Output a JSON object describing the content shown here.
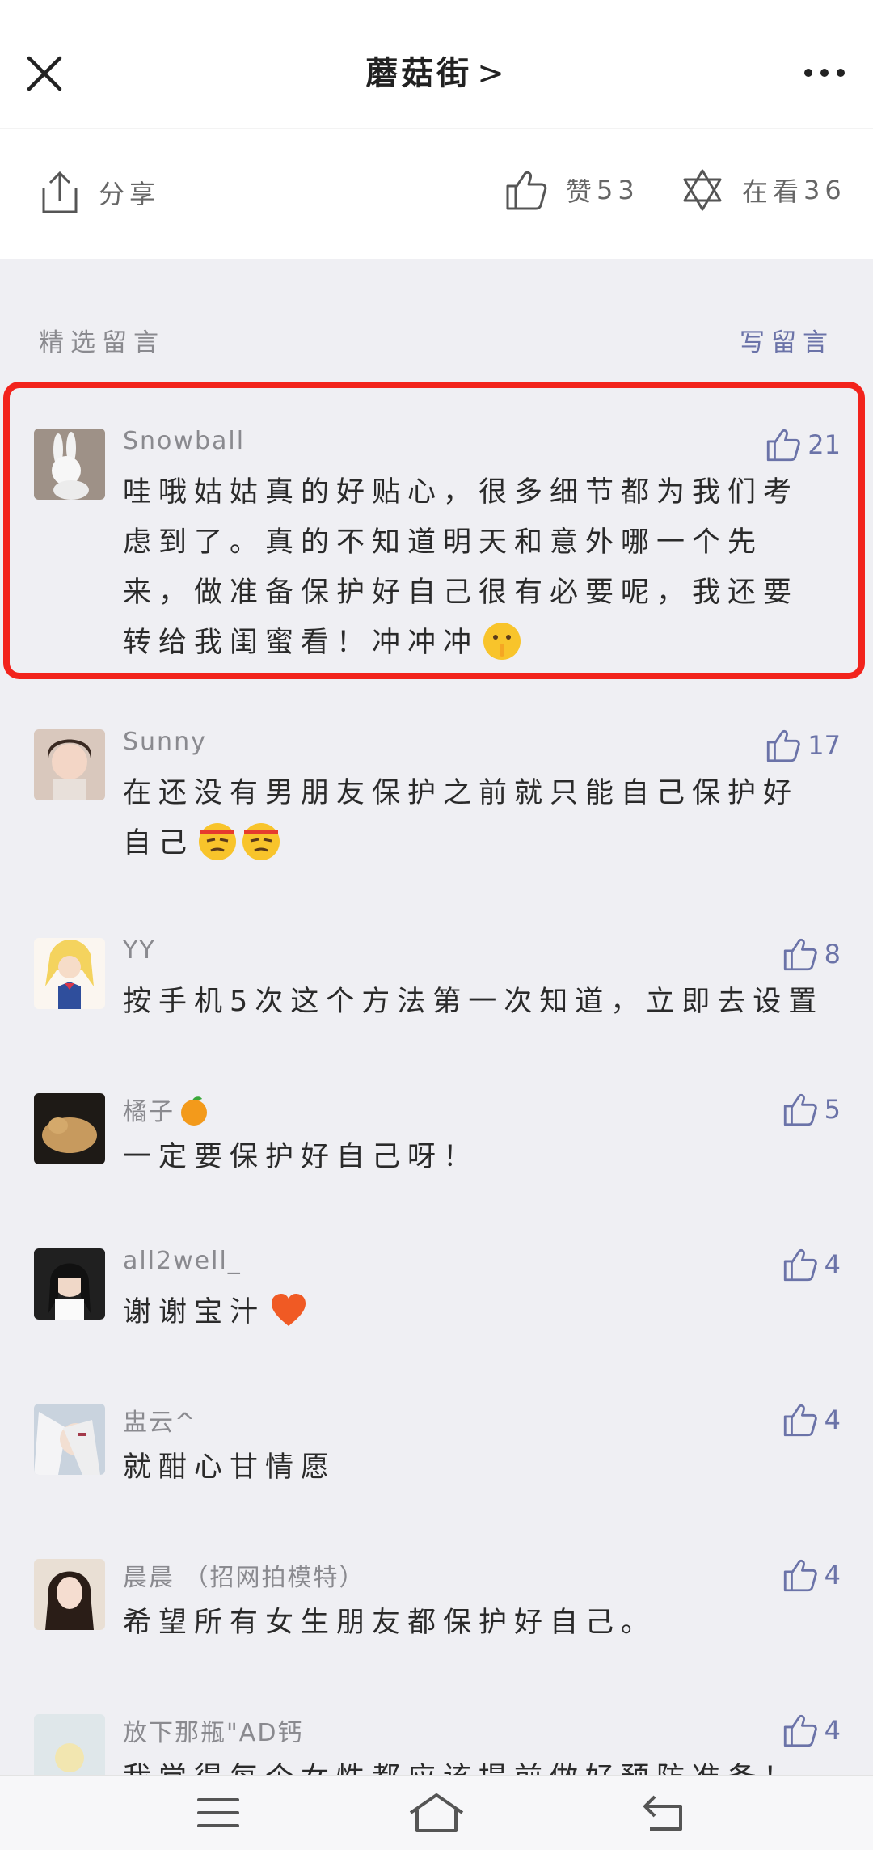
{
  "header": {
    "title": "蘑菇街",
    "title_chevron": ">"
  },
  "actions": {
    "share_label": "分享",
    "like_label": "赞",
    "like_count": "53",
    "wow_label": "在看",
    "wow_count": "36"
  },
  "section": {
    "title": "精选留言",
    "write_label": "写留言"
  },
  "comments": [
    {
      "name": "Snowball",
      "text": "哇哦姑姑真的好贴心，很多细节都为我们考虑到了。真的不知道明天和意外哪一个先来，做准备保护好自己很有必要呢，我还要转给我闺蜜看！冲冲冲",
      "likes": "21"
    },
    {
      "name": "Sunny",
      "text": "在还没有男朋友保护之前就只能自己保护好自己",
      "likes": "17"
    },
    {
      "name": "YY",
      "text": "按手机5次这个方法第一次知道，立即去设置",
      "likes": "8"
    },
    {
      "name": "橘子",
      "text": "一定要保护好自己呀！",
      "likes": "5"
    },
    {
      "name": "all2well_",
      "text": "谢谢宝汁",
      "likes": "4"
    },
    {
      "name": "盅云^",
      "text": "就酣心甘情愿",
      "likes": "4"
    },
    {
      "name": "晨晨 （招网拍模特）",
      "text": "希望所有女生朋友都保护好自己。",
      "likes": "4"
    },
    {
      "name": "放下那瓶\"AD钙",
      "text": "我觉得每个女性都应该提前做好预防准备！",
      "likes": "4"
    }
  ],
  "colors": {
    "accent": "#6b73a8",
    "highlight": "#f2231c",
    "background": "#efeff3"
  }
}
